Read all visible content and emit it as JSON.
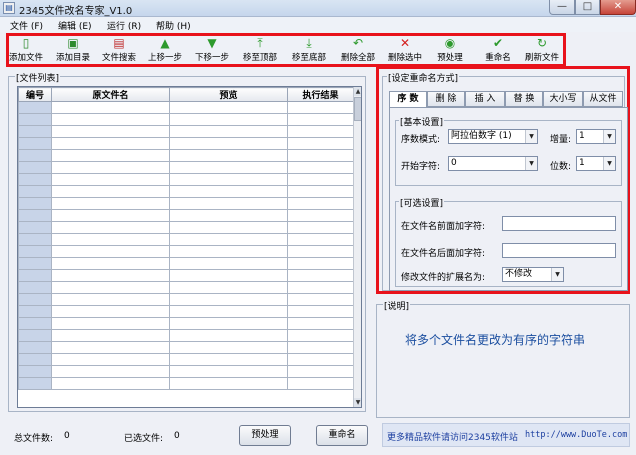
{
  "window": {
    "title": "2345文件改名专家_V1.0",
    "min": "—",
    "max": "□",
    "close": "✕"
  },
  "menu": [
    {
      "label": "文件 (F)"
    },
    {
      "label": "编辑 (E)"
    },
    {
      "label": "运行 (R)"
    },
    {
      "label": "帮助 (H)"
    }
  ],
  "toolbar": {
    "items": [
      {
        "label": "添加文件",
        "icon": "add-file-icon",
        "glyph": "▯",
        "color": "#2e8b2e"
      },
      {
        "label": "添加目录",
        "icon": "add-folder-icon",
        "glyph": "▣",
        "color": "#2e8b2e"
      },
      {
        "label": "文件搜索",
        "icon": "file-search-icon",
        "glyph": "▤",
        "color": "#c03030"
      },
      {
        "label": "上移一步",
        "icon": "move-up-icon",
        "glyph": "▲",
        "color": "#2d9a2d"
      },
      {
        "label": "下移一步",
        "icon": "move-down-icon",
        "glyph": "▼",
        "color": "#2d9a2d"
      },
      {
        "label": "移至顶部",
        "icon": "move-top-icon",
        "glyph": "⤒",
        "color": "#2d9a2d"
      },
      {
        "label": "移至底部",
        "icon": "move-bottom-icon",
        "glyph": "⤓",
        "color": "#2d9a2d"
      },
      {
        "label": "删除全部",
        "icon": "delete-all-icon",
        "glyph": "↶",
        "color": "#2d9a2d"
      },
      {
        "label": "删除选中",
        "icon": "delete-selected-icon",
        "glyph": "✕",
        "color": "#d42020"
      },
      {
        "label": "预处理",
        "icon": "preprocess-icon",
        "glyph": "◉",
        "color": "#2d9a2d"
      },
      {
        "label": "重命名",
        "icon": "rename-icon",
        "glyph": "✔",
        "color": "#2d9a2d"
      },
      {
        "label": "刷新文件",
        "icon": "refresh-icon",
        "glyph": "↻",
        "color": "#2d9a2d"
      }
    ]
  },
  "file_list": {
    "legend": "[文件列表]",
    "columns": [
      "编号",
      "原文件名",
      "预览",
      "执行结果"
    ]
  },
  "settings": {
    "legend": "[设定重命名方式]",
    "tabs": [
      "序 数",
      "删 除",
      "插 入",
      "替 换",
      "大小写",
      "从文件"
    ],
    "basic": {
      "legend": "[基本设置]",
      "mode_label": "序数模式:",
      "mode_value": "阿拉伯数字 (1)",
      "increment_label": "增量:",
      "increment_value": "1",
      "start_label": "开始字符:",
      "start_value": "0",
      "digits_label": "位数:",
      "digits_value": "1"
    },
    "optional": {
      "legend": "[可选设置]",
      "prefix_label": "在文件名前面加字符:",
      "prefix_value": "",
      "suffix_label": "在文件名后面加字符:",
      "suffix_value": "",
      "ext_label": "修改文件的扩展名为:",
      "ext_value": "不修改"
    }
  },
  "description": {
    "legend": "[说明]",
    "text": "将多个文件名更改为有序的字符串"
  },
  "status": {
    "total_label": "总文件数:",
    "total_value": "0",
    "selected_label": "已选文件:",
    "selected_value": "0",
    "preprocess_button": "预处理",
    "rename_button": "重命名",
    "promo_text": "更多精品软件请访问2345软件站",
    "promo_url": "http://www.DuoTe.com"
  },
  "colors": {
    "highlight_border": "#e8121b",
    "link": "#1c4fa0"
  }
}
